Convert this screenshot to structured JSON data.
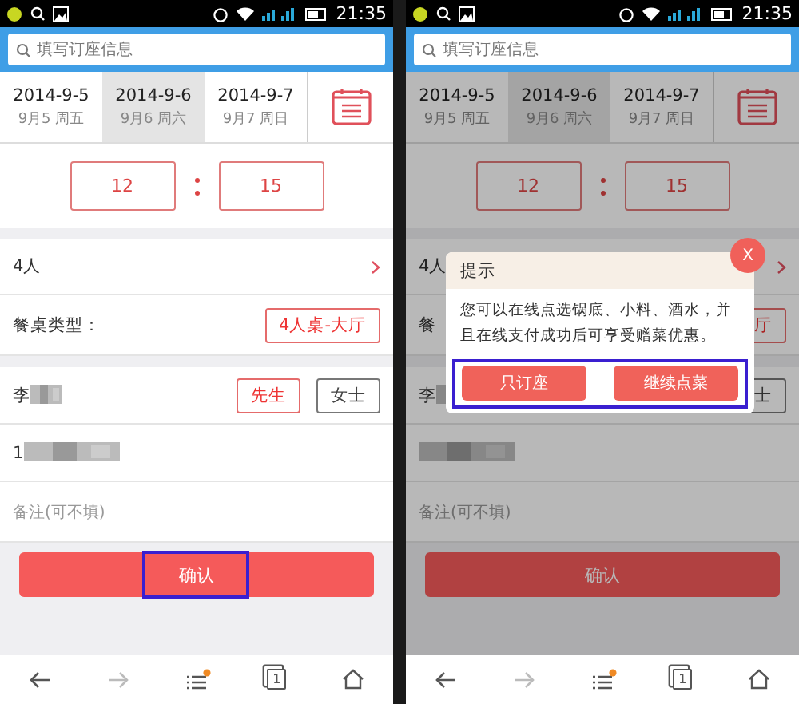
{
  "phones": [
    {
      "status_bar": {
        "time": "21:35"
      },
      "search": {
        "placeholder": "填写订座信息"
      },
      "dates": [
        {
          "date": "2014-9-5",
          "day": "9月5 周五",
          "selected": false
        },
        {
          "date": "2014-9-6",
          "day": "9月6 周六",
          "selected": true
        },
        {
          "date": "2014-9-7",
          "day": "9月7 周日",
          "selected": false
        }
      ],
      "time": {
        "hour": "12",
        "minute": "15"
      },
      "party": "4人",
      "table_type": {
        "label": "餐桌类型：",
        "value": "4人桌-大厅"
      },
      "name": "李",
      "salutations": [
        {
          "label": "先生",
          "selected": true
        },
        {
          "label": "女士",
          "selected": false
        }
      ],
      "phone": "1",
      "notes": {
        "placeholder": "备注(可不填)"
      },
      "confirm": {
        "label": "确认",
        "highlighted": true
      },
      "nav": {
        "tab_count": "1"
      }
    },
    {
      "status_bar": {
        "time": "21:35"
      },
      "search": {
        "placeholder": "填写订座信息"
      },
      "dates": [
        {
          "date": "2014-9-5",
          "day": "9月5 周五",
          "selected": false
        },
        {
          "date": "2014-9-6",
          "day": "9月6 周六",
          "selected": true
        },
        {
          "date": "2014-9-7",
          "day": "9月7 周日",
          "selected": false
        }
      ],
      "time": {
        "hour": "12",
        "minute": "15"
      },
      "party": "4人",
      "table_type": {
        "label": "餐",
        "value": "厅"
      },
      "name": "李",
      "salutations": [
        {
          "label": "士",
          "selected": false
        }
      ],
      "notes": {
        "placeholder": "备注(可不填)"
      },
      "confirm": {
        "label": "确认",
        "highlighted": false
      },
      "nav": {
        "tab_count": "1"
      },
      "dialog": {
        "title": "提示",
        "close": "X",
        "message": "您可以在线点选锅底、小料、酒水，并且在线支付成功后可享受赠菜优惠。",
        "buttons": [
          "只订座",
          "继续点菜"
        ],
        "buttons_highlighted": true
      }
    }
  ]
}
